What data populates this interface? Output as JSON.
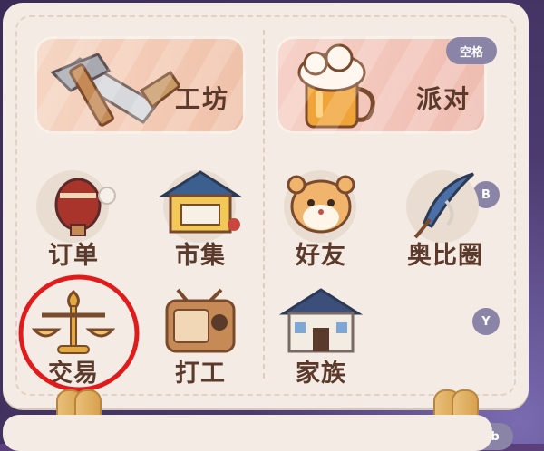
{
  "colors": {
    "panel": "#f4ece4",
    "text": "#5b3a2c",
    "badge": "#8a84a6",
    "highlight": "#e11b1b"
  },
  "top_buttons": [
    {
      "label": "工坊",
      "icon": "hammer-saw-icon"
    },
    {
      "label": "派对",
      "icon": "beer-mug-icon"
    }
  ],
  "hotkeys": {
    "space": "空格",
    "b": "B",
    "y": "Y",
    "tab": "Tab"
  },
  "left_items": [
    {
      "label": "订单",
      "icon": "hot-air-balloon-icon"
    },
    {
      "label": "市集",
      "icon": "market-stall-icon"
    },
    {
      "label": "交易",
      "icon": "scales-icon"
    },
    {
      "label": "打工",
      "icon": "radio-icon"
    }
  ],
  "right_items": [
    {
      "label": "好友",
      "icon": "hamster-icon"
    },
    {
      "label": "奥比圈",
      "icon": "feather-quill-icon"
    },
    {
      "label": "家族",
      "icon": "house-icon"
    }
  ]
}
